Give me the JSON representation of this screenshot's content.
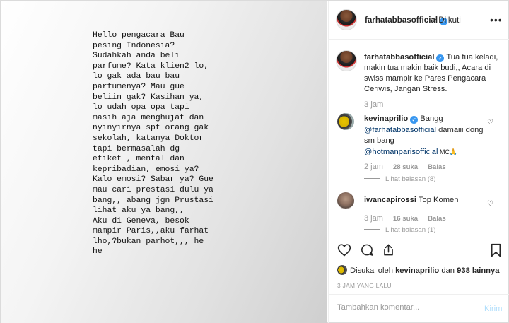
{
  "story": {
    "text": "Hello pengacara Bau\npesing Indonesia?\nSudahkah anda beli\nparfume? Kata klien2 lo,\nlo gak ada bau bau\nparfumenya? Mau gue\nbeliin gak? Kasihan ya,\nlo udah opa opa tapi\nmasih aja menghujat dan\nnyinyirnya spt orang gak\nsekolah, katanya Doktor\ntapi bermasalah dg\netiket , mental dan\nkepribadian, emosi ya?\nKalo emosi? Sabar ya? Gue\nmau cari prestasi dulu ya\nbang,, abang jgn Prustasi\nlihat aku ya bang,,\nAku di Geneva, besok\nmampir Paris,,aku farhat\nlho,?bukan parhot,,, he\nhe"
  },
  "header": {
    "username": "farhatabbasofficial",
    "separator": "•",
    "follow_label": "Diikuti",
    "more_icon": "ellipsis-icon"
  },
  "caption": {
    "username": "farhatabbasofficial",
    "text": " Tua tua keladi, makin tua makin baik budi,, Acara di swiss mampir ke Pares Pengacara Ceriwis, Jangan Stress.",
    "time": "3 jam"
  },
  "comments": [
    {
      "username": "kevinaprilio",
      "text_before": " Bangg",
      "mention1": "@farhatabbasofficial",
      "text_mid": " damaiii dong sm bang",
      "mention2": "@hotmanparisofficial",
      "text_after": " MC🙏",
      "time": "2 jam",
      "likes": "28 suka",
      "reply": "Balas",
      "view_replies": "Lihat balasan (8)"
    },
    {
      "username": "iwancapirossi",
      "text": " Top Komen",
      "time": "3 jam",
      "likes": "16 suka",
      "reply": "Balas",
      "view_replies": "Lihat balasan (1)"
    }
  ],
  "likes_line": {
    "prefix": "Disukai oleh ",
    "user": "kevinaprilio",
    "middle": " dan ",
    "count": "938 lainnya"
  },
  "time_ago": "3 JAM YANG LALU",
  "comment_box": {
    "placeholder": "Tambahkan komentar...",
    "post_label": "Kirim"
  },
  "colors": {
    "accent": "#3897f0",
    "mention": "#003569",
    "muted": "#999999"
  }
}
